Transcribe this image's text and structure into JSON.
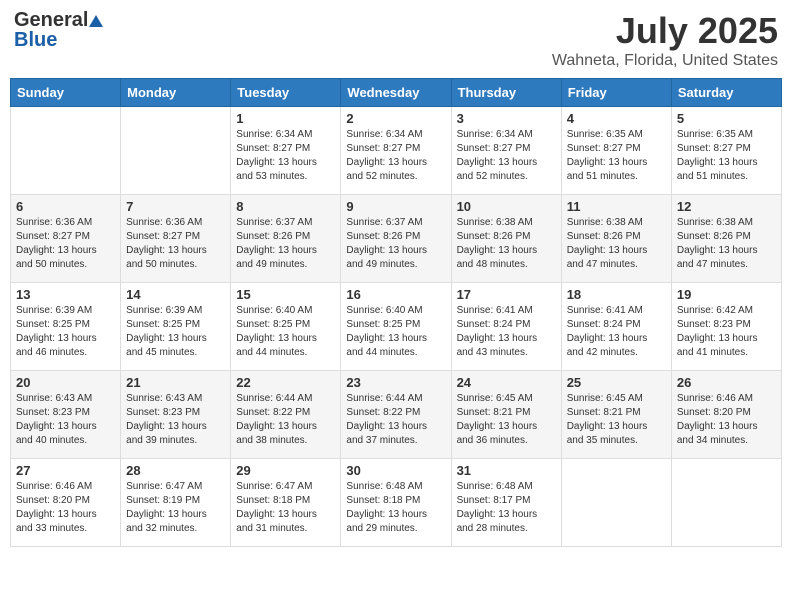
{
  "header": {
    "logo_general": "General",
    "logo_blue": "Blue",
    "title": "July 2025",
    "subtitle": "Wahneta, Florida, United States"
  },
  "calendar": {
    "days_of_week": [
      "Sunday",
      "Monday",
      "Tuesday",
      "Wednesday",
      "Thursday",
      "Friday",
      "Saturday"
    ],
    "weeks": [
      [
        {
          "day": "",
          "info": ""
        },
        {
          "day": "",
          "info": ""
        },
        {
          "day": "1",
          "info": "Sunrise: 6:34 AM\nSunset: 8:27 PM\nDaylight: 13 hours and 53 minutes."
        },
        {
          "day": "2",
          "info": "Sunrise: 6:34 AM\nSunset: 8:27 PM\nDaylight: 13 hours and 52 minutes."
        },
        {
          "day": "3",
          "info": "Sunrise: 6:34 AM\nSunset: 8:27 PM\nDaylight: 13 hours and 52 minutes."
        },
        {
          "day": "4",
          "info": "Sunrise: 6:35 AM\nSunset: 8:27 PM\nDaylight: 13 hours and 51 minutes."
        },
        {
          "day": "5",
          "info": "Sunrise: 6:35 AM\nSunset: 8:27 PM\nDaylight: 13 hours and 51 minutes."
        }
      ],
      [
        {
          "day": "6",
          "info": "Sunrise: 6:36 AM\nSunset: 8:27 PM\nDaylight: 13 hours and 50 minutes."
        },
        {
          "day": "7",
          "info": "Sunrise: 6:36 AM\nSunset: 8:27 PM\nDaylight: 13 hours and 50 minutes."
        },
        {
          "day": "8",
          "info": "Sunrise: 6:37 AM\nSunset: 8:26 PM\nDaylight: 13 hours and 49 minutes."
        },
        {
          "day": "9",
          "info": "Sunrise: 6:37 AM\nSunset: 8:26 PM\nDaylight: 13 hours and 49 minutes."
        },
        {
          "day": "10",
          "info": "Sunrise: 6:38 AM\nSunset: 8:26 PM\nDaylight: 13 hours and 48 minutes."
        },
        {
          "day": "11",
          "info": "Sunrise: 6:38 AM\nSunset: 8:26 PM\nDaylight: 13 hours and 47 minutes."
        },
        {
          "day": "12",
          "info": "Sunrise: 6:38 AM\nSunset: 8:26 PM\nDaylight: 13 hours and 47 minutes."
        }
      ],
      [
        {
          "day": "13",
          "info": "Sunrise: 6:39 AM\nSunset: 8:25 PM\nDaylight: 13 hours and 46 minutes."
        },
        {
          "day": "14",
          "info": "Sunrise: 6:39 AM\nSunset: 8:25 PM\nDaylight: 13 hours and 45 minutes."
        },
        {
          "day": "15",
          "info": "Sunrise: 6:40 AM\nSunset: 8:25 PM\nDaylight: 13 hours and 44 minutes."
        },
        {
          "day": "16",
          "info": "Sunrise: 6:40 AM\nSunset: 8:25 PM\nDaylight: 13 hours and 44 minutes."
        },
        {
          "day": "17",
          "info": "Sunrise: 6:41 AM\nSunset: 8:24 PM\nDaylight: 13 hours and 43 minutes."
        },
        {
          "day": "18",
          "info": "Sunrise: 6:41 AM\nSunset: 8:24 PM\nDaylight: 13 hours and 42 minutes."
        },
        {
          "day": "19",
          "info": "Sunrise: 6:42 AM\nSunset: 8:23 PM\nDaylight: 13 hours and 41 minutes."
        }
      ],
      [
        {
          "day": "20",
          "info": "Sunrise: 6:43 AM\nSunset: 8:23 PM\nDaylight: 13 hours and 40 minutes."
        },
        {
          "day": "21",
          "info": "Sunrise: 6:43 AM\nSunset: 8:23 PM\nDaylight: 13 hours and 39 minutes."
        },
        {
          "day": "22",
          "info": "Sunrise: 6:44 AM\nSunset: 8:22 PM\nDaylight: 13 hours and 38 minutes."
        },
        {
          "day": "23",
          "info": "Sunrise: 6:44 AM\nSunset: 8:22 PM\nDaylight: 13 hours and 37 minutes."
        },
        {
          "day": "24",
          "info": "Sunrise: 6:45 AM\nSunset: 8:21 PM\nDaylight: 13 hours and 36 minutes."
        },
        {
          "day": "25",
          "info": "Sunrise: 6:45 AM\nSunset: 8:21 PM\nDaylight: 13 hours and 35 minutes."
        },
        {
          "day": "26",
          "info": "Sunrise: 6:46 AM\nSunset: 8:20 PM\nDaylight: 13 hours and 34 minutes."
        }
      ],
      [
        {
          "day": "27",
          "info": "Sunrise: 6:46 AM\nSunset: 8:20 PM\nDaylight: 13 hours and 33 minutes."
        },
        {
          "day": "28",
          "info": "Sunrise: 6:47 AM\nSunset: 8:19 PM\nDaylight: 13 hours and 32 minutes."
        },
        {
          "day": "29",
          "info": "Sunrise: 6:47 AM\nSunset: 8:18 PM\nDaylight: 13 hours and 31 minutes."
        },
        {
          "day": "30",
          "info": "Sunrise: 6:48 AM\nSunset: 8:18 PM\nDaylight: 13 hours and 29 minutes."
        },
        {
          "day": "31",
          "info": "Sunrise: 6:48 AM\nSunset: 8:17 PM\nDaylight: 13 hours and 28 minutes."
        },
        {
          "day": "",
          "info": ""
        },
        {
          "day": "",
          "info": ""
        }
      ]
    ]
  }
}
